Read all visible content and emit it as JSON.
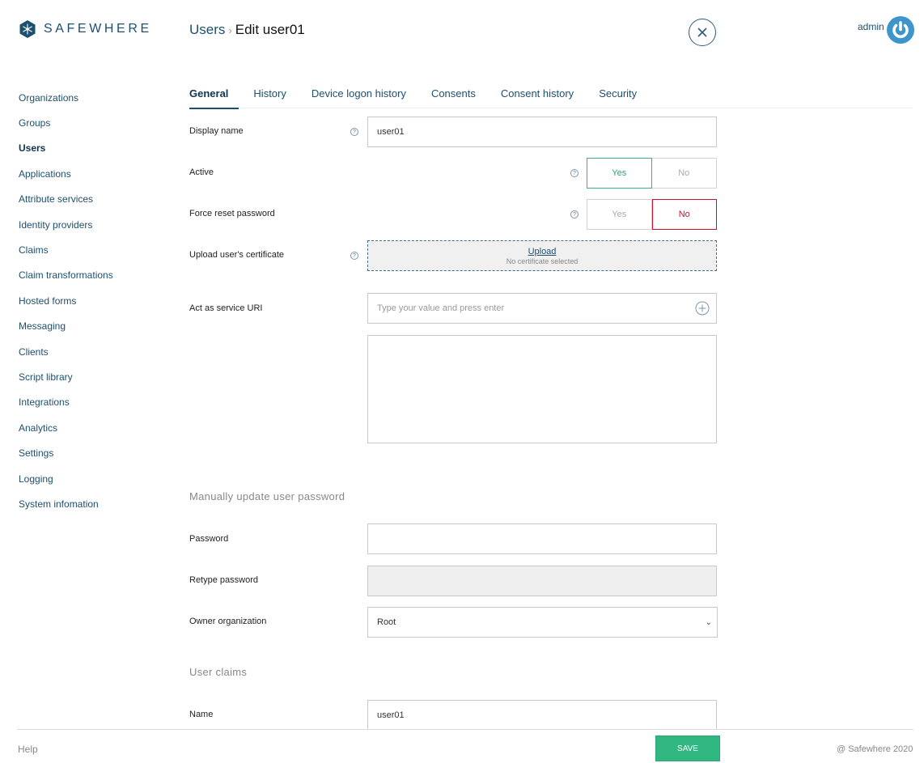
{
  "brand": {
    "name": "SAFEWHERE",
    "logo_icon": "snowflake-hexagon-icon",
    "color": "#1d4f6e"
  },
  "breadcrumb": {
    "parent": "Users",
    "separator": "›",
    "current": "Edit user01"
  },
  "header": {
    "close_icon": "close-circle-icon",
    "user": "admin",
    "power_icon": "power-icon"
  },
  "sidebar": {
    "items": [
      {
        "label": "Organizations",
        "active": false
      },
      {
        "label": "Groups",
        "active": false
      },
      {
        "label": "Users",
        "active": true
      },
      {
        "label": "Applications",
        "active": false
      },
      {
        "label": "Attribute services",
        "active": false
      },
      {
        "label": "Identity providers",
        "active": false
      },
      {
        "label": "Claims",
        "active": false
      },
      {
        "label": "Claim transformations",
        "active": false
      },
      {
        "label": "Hosted forms",
        "active": false
      },
      {
        "label": "Messaging",
        "active": false
      },
      {
        "label": "Clients",
        "active": false
      },
      {
        "label": "Script library",
        "active": false
      },
      {
        "label": "Integrations",
        "active": false
      },
      {
        "label": "Analytics",
        "active": false
      },
      {
        "label": "Settings",
        "active": false
      },
      {
        "label": "Logging",
        "active": false
      },
      {
        "label": "System infomation",
        "active": false
      }
    ]
  },
  "tabs": [
    {
      "label": "General",
      "active": true
    },
    {
      "label": "History",
      "active": false
    },
    {
      "label": "Device logon history",
      "active": false
    },
    {
      "label": "Consents",
      "active": false
    },
    {
      "label": "Consent history",
      "active": false
    },
    {
      "label": "Security",
      "active": false
    }
  ],
  "form": {
    "display_name": {
      "label": "Display name",
      "value": "user01"
    },
    "active": {
      "label": "Active",
      "yes": "Yes",
      "no": "No",
      "selected": "Yes"
    },
    "force_reset": {
      "label": "Force reset password",
      "yes": "Yes",
      "no": "No",
      "selected": "No"
    },
    "certificate": {
      "label": "Upload user's certificate",
      "upload_label": "Upload",
      "status": "No certificate selected"
    },
    "act_as_service": {
      "label": "Act as service URI",
      "placeholder": "Type your value and press enter"
    },
    "password_section": "Manually update user password",
    "password": {
      "label": "Password",
      "value": ""
    },
    "retype_password": {
      "label": "Retype password",
      "value": ""
    },
    "owner_org": {
      "label": "Owner organization",
      "value": "Root"
    },
    "claims_section": "User claims",
    "claim_name": {
      "label": "Name",
      "value": "user01"
    }
  },
  "footer": {
    "help": "Help",
    "save": "SAVE",
    "copyright": "@ Safewhere 2020"
  },
  "colors": {
    "success": "#31b782",
    "danger": "#c8102e",
    "link": "#1d4f6e"
  }
}
